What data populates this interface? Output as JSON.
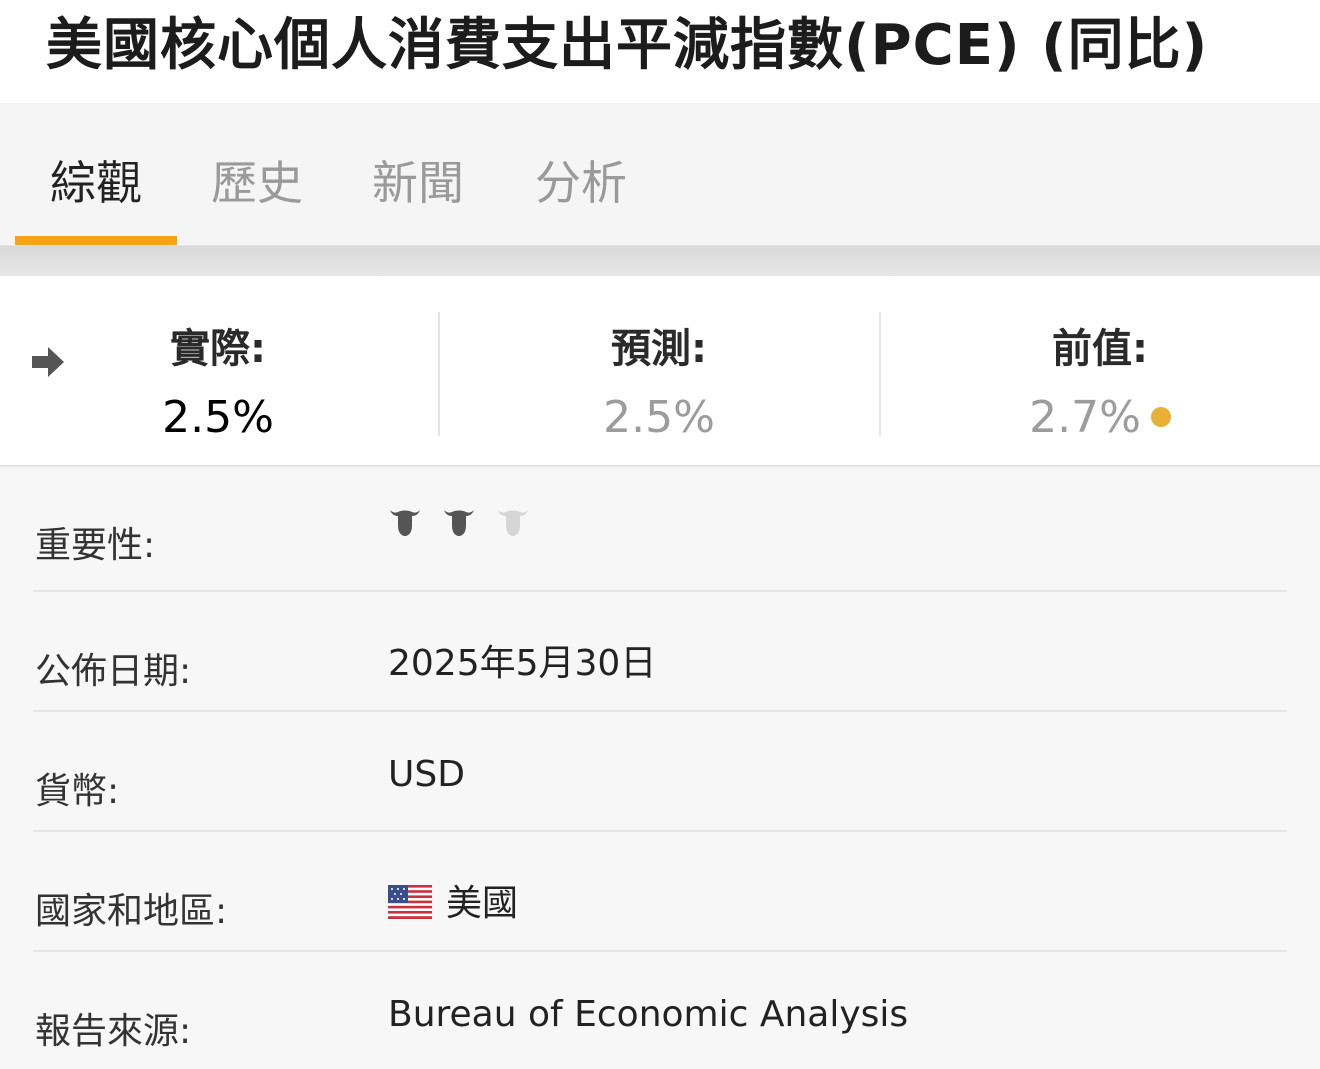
{
  "header": {
    "title": "美國核心個人消費支出平減指數(PCE) (同比)"
  },
  "tabs": [
    {
      "label": "綜觀",
      "active": true
    },
    {
      "label": "歷史",
      "active": false
    },
    {
      "label": "新聞",
      "active": false
    },
    {
      "label": "分析",
      "active": false
    }
  ],
  "stats": {
    "indicator_icon": "arrow-right-icon",
    "actual": {
      "label": "實際:",
      "value": "2.5%"
    },
    "forecast": {
      "label": "預測:",
      "value": "2.5%"
    },
    "previous": {
      "label": "前值:",
      "value": "2.7%",
      "dot_color": "#e8b035"
    }
  },
  "details": {
    "importance": {
      "label": "重要性:",
      "level": 2,
      "max": 3,
      "icon": "bull-icon"
    },
    "release_date": {
      "label": "公佈日期:",
      "value": "2025年5月30日"
    },
    "currency": {
      "label": "貨幣:",
      "value": "USD"
    },
    "country": {
      "label": "國家和地區:",
      "value": "美國",
      "flag": "us-flag-icon"
    },
    "source": {
      "label": "報告來源:",
      "value": "Bureau of Economic Analysis"
    }
  },
  "colors": {
    "accent": "#f6a316",
    "link": "#1b5ca8",
    "bull_active": "#555555",
    "bull_inactive": "#d6d6d6"
  }
}
